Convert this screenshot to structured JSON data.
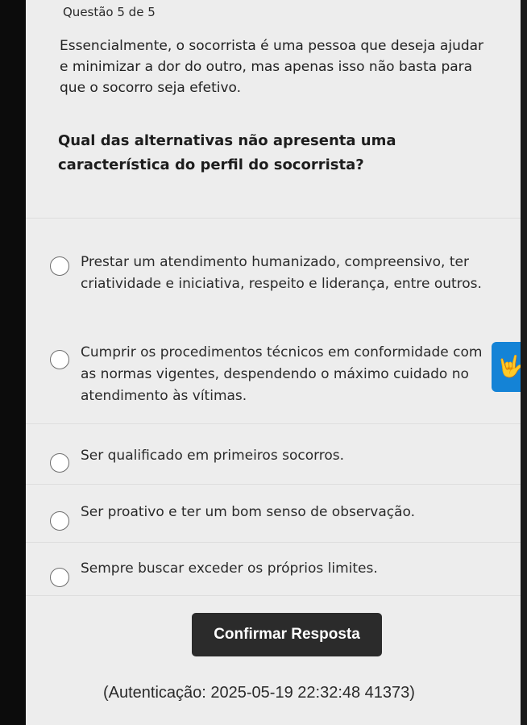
{
  "header": {
    "title": "Questão 5 de 5"
  },
  "statement": "Essencialmente, o socorrista é uma pessoa que deseja ajudar e minimizar a dor do outro, mas apenas isso não basta para que o socorro seja efetivo.",
  "question": "Qual das alternativas não apresenta uma característica do perfil do socorrista?",
  "options": [
    {
      "label": "Prestar um atendimento humanizado, compreensivo, ter criatividade e iniciativa, respeito e liderança, entre outros."
    },
    {
      "label": "Cumprir os procedimentos técnicos em conformidade com as normas vigentes, despendendo o máximo cuidado no atendimento às vítimas."
    },
    {
      "label": "Ser qualificado em primeiros socorros."
    },
    {
      "label": "Ser proativo e ter um bom senso de observação."
    },
    {
      "label": "Sempre buscar exceder os próprios limites."
    }
  ],
  "confirm_button": {
    "label": "Confirmar Resposta"
  },
  "auth_text": "(Autenticação: 2025-05-19 22:32:48 41373)",
  "accessibility_widget": {
    "icon": "sign-language-icon",
    "glyph": "🤟"
  },
  "colors": {
    "button_bg": "#2b2b2b",
    "widget_bg": "#1483d6",
    "page_bg": "#ededed"
  }
}
